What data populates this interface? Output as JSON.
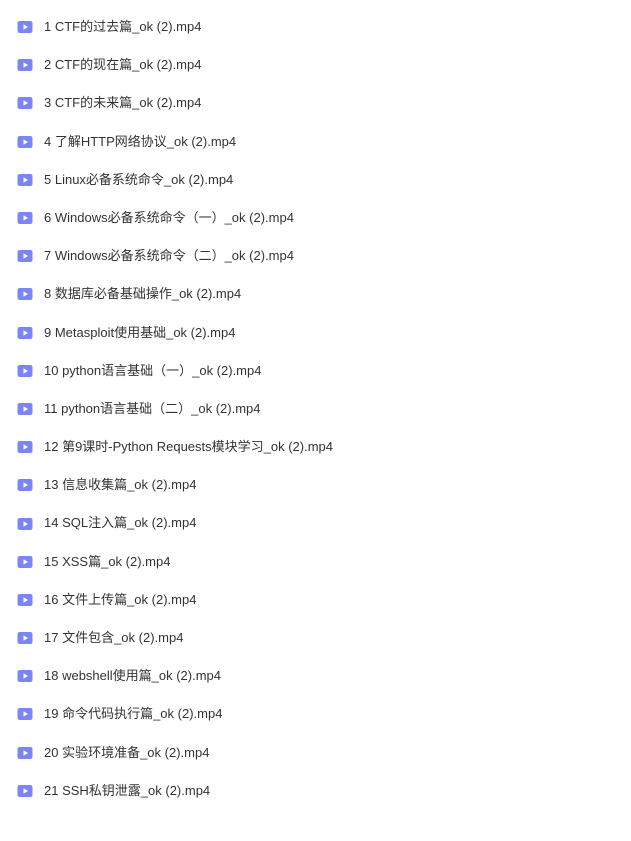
{
  "files": [
    {
      "name": "1 CTF的过去篇_ok (2).mp4"
    },
    {
      "name": "2 CTF的现在篇_ok (2).mp4"
    },
    {
      "name": "3 CTF的未来篇_ok (2).mp4"
    },
    {
      "name": "4 了解HTTP网络协议_ok (2).mp4"
    },
    {
      "name": "5 Linux必备系统命令_ok (2).mp4"
    },
    {
      "name": "6 Windows必备系统命令（一）_ok (2).mp4"
    },
    {
      "name": "7 Windows必备系统命令（二）_ok (2).mp4"
    },
    {
      "name": "8 数据库必备基础操作_ok (2).mp4"
    },
    {
      "name": "9 Metasploit使用基础_ok (2).mp4"
    },
    {
      "name": "10 python语言基础（一）_ok (2).mp4"
    },
    {
      "name": "11 python语言基础（二）_ok (2).mp4"
    },
    {
      "name": "12 第9课时-Python Requests模块学习_ok (2).mp4"
    },
    {
      "name": "13 信息收集篇_ok (2).mp4"
    },
    {
      "name": "14 SQL注入篇_ok (2).mp4"
    },
    {
      "name": "15 XSS篇_ok (2).mp4"
    },
    {
      "name": "16 文件上传篇_ok (2).mp4"
    },
    {
      "name": "17 文件包含_ok (2).mp4"
    },
    {
      "name": "18 webshell使用篇_ok (2).mp4"
    },
    {
      "name": "19 命令代码执行篇_ok (2).mp4"
    },
    {
      "name": "20 实验环境准备_ok (2).mp4"
    },
    {
      "name": "21 SSH私钥泄露_ok (2).mp4"
    }
  ],
  "icon_color": "#7b86f4"
}
